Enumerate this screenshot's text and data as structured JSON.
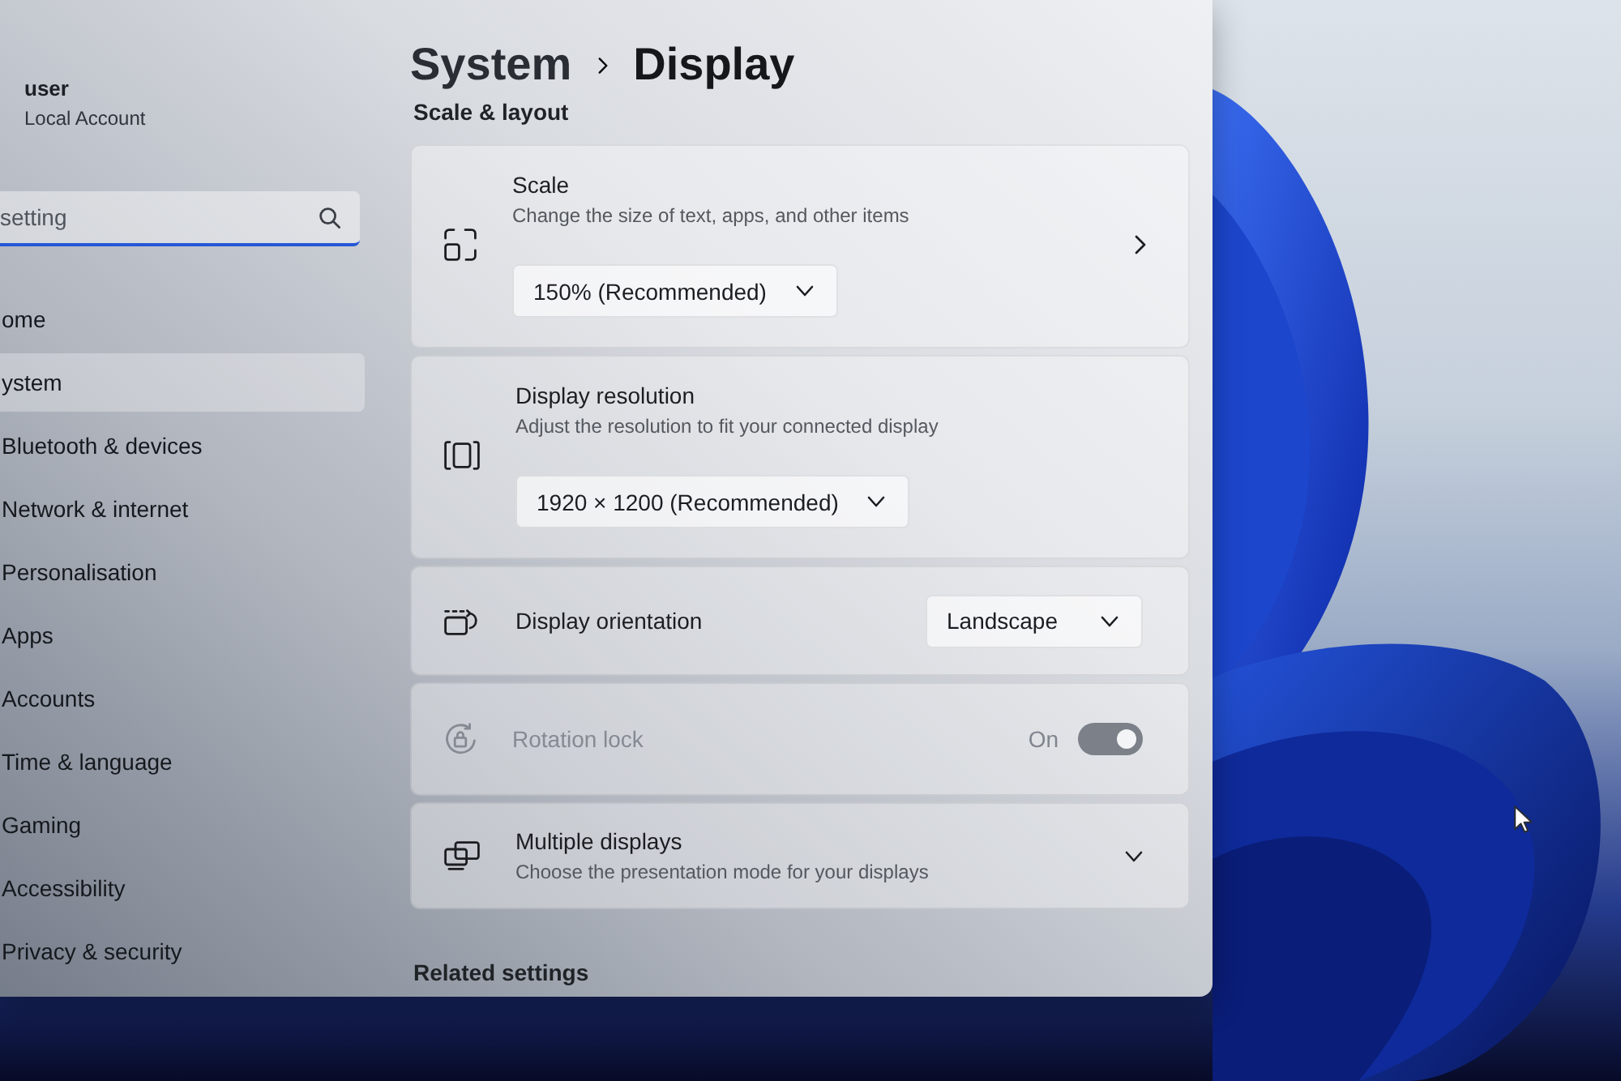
{
  "account": {
    "name": "user",
    "type": "Local Account"
  },
  "search": {
    "placeholder": "setting"
  },
  "sidebar": {
    "items": [
      {
        "label": "ome",
        "selected": false
      },
      {
        "label": "ystem",
        "selected": true
      },
      {
        "label": "Bluetooth & devices",
        "selected": false
      },
      {
        "label": "Network & internet",
        "selected": false
      },
      {
        "label": "Personalisation",
        "selected": false
      },
      {
        "label": "Apps",
        "selected": false
      },
      {
        "label": "Accounts",
        "selected": false
      },
      {
        "label": "Time & language",
        "selected": false
      },
      {
        "label": "Gaming",
        "selected": false
      },
      {
        "label": "Accessibility",
        "selected": false
      },
      {
        "label": "Privacy & security",
        "selected": false
      }
    ]
  },
  "header": {
    "breadcrumb": [
      "System",
      "Display"
    ]
  },
  "section": {
    "title": "Scale & layout",
    "cards": [
      {
        "kind": "stacked",
        "title": "Scale",
        "description": "Change the size of text, apps, and other items",
        "value": "150% (Recommended)",
        "navigates": true,
        "disabled": false
      },
      {
        "kind": "stacked",
        "title": "Display resolution",
        "description": "Adjust the resolution to fit your connected display",
        "value": "1920 × 1200 (Recommended)",
        "navigates": false,
        "disabled": false
      },
      {
        "kind": "inline",
        "title": "Display orientation",
        "value": "Landscape",
        "disabled": false
      },
      {
        "kind": "toggle",
        "title": "Rotation lock",
        "state_label": "On",
        "on": true,
        "disabled": true
      },
      {
        "kind": "expander",
        "title": "Multiple displays",
        "description": "Choose the presentation mode for your displays",
        "expanded": false,
        "disabled": false
      }
    ]
  },
  "related": {
    "title": "Related settings"
  }
}
